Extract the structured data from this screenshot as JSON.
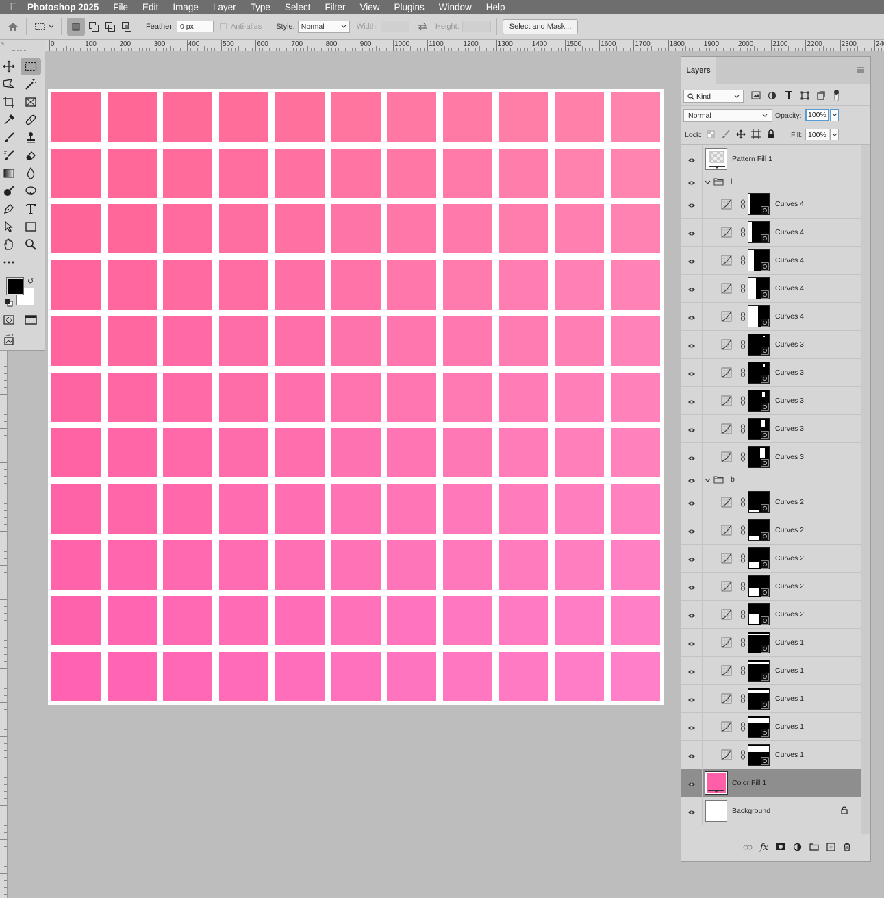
{
  "menubar": {
    "app_name": "Photoshop 2025",
    "items": [
      "File",
      "Edit",
      "Image",
      "Layer",
      "Type",
      "Select",
      "Filter",
      "View",
      "Plugins",
      "Window",
      "Help"
    ]
  },
  "options_bar": {
    "feather_label": "Feather:",
    "feather_value": "0 px",
    "anti_alias_label": "Anti-alias",
    "style_label": "Style:",
    "style_value": "Normal",
    "width_label": "Width:",
    "height_label": "Height:",
    "select_mask_label": "Select and Mask..."
  },
  "ruler": {
    "labels": [
      "0",
      "100",
      "200",
      "300",
      "400",
      "500",
      "600",
      "700",
      "800",
      "900",
      "1000",
      "1100",
      "1200",
      "1300",
      "1400",
      "1500",
      "1600",
      "1700",
      "1800",
      "1900",
      "2000",
      "2100",
      "2200",
      "2300",
      "240"
    ]
  },
  "colors": {
    "grid_top_left": "#ff6593",
    "grid_top_right": "#ff84ad",
    "grid_bottom_left": "#ff62b0",
    "grid_bottom_right": "#ff80c8",
    "color_fill": "#ff5fa8",
    "selected_row": "#8e8e8e"
  },
  "grid": {
    "rows": 11,
    "cols": 11
  },
  "layers_panel": {
    "tab_label": "Layers",
    "kind_label": "Kind",
    "blend_mode": "Normal",
    "opacity_label": "Opacity:",
    "opacity_value": "100%",
    "lock_label": "Lock:",
    "fill_label": "Fill:",
    "fill_value": "100%",
    "layers": [
      {
        "name": "Pattern Fill 1",
        "type": "pattern"
      },
      {
        "name": "l",
        "type": "group"
      },
      {
        "name": "Curves 4",
        "type": "curves",
        "shape": "vleft",
        "level": 0.05
      },
      {
        "name": "Curves 4",
        "type": "curves",
        "shape": "vleft",
        "level": 0.15
      },
      {
        "name": "Curves 4",
        "type": "curves",
        "shape": "vleft",
        "level": 0.25
      },
      {
        "name": "Curves 4",
        "type": "curves",
        "shape": "vleft",
        "level": 0.35
      },
      {
        "name": "Curves 4",
        "type": "curves",
        "shape": "vleft",
        "level": 0.45
      },
      {
        "name": "Curves 3",
        "type": "curves",
        "shape": "vright",
        "level": 0.08
      },
      {
        "name": "Curves 3",
        "type": "curves",
        "shape": "vright",
        "level": 0.18
      },
      {
        "name": "Curves 3",
        "type": "curves",
        "shape": "vright",
        "level": 0.28
      },
      {
        "name": "Curves 3",
        "type": "curves",
        "shape": "vright",
        "level": 0.38
      },
      {
        "name": "Curves 3",
        "type": "curves",
        "shape": "vright",
        "level": 0.48
      },
      {
        "name": "b",
        "type": "group"
      },
      {
        "name": "Curves 2",
        "type": "curves",
        "shape": "hbottom",
        "level": 0.08
      },
      {
        "name": "Curves 2",
        "type": "curves",
        "shape": "hbottom",
        "level": 0.18
      },
      {
        "name": "Curves 2",
        "type": "curves",
        "shape": "hbottom",
        "level": 0.28
      },
      {
        "name": "Curves 2",
        "type": "curves",
        "shape": "hbottom",
        "level": 0.38
      },
      {
        "name": "Curves 2",
        "type": "curves",
        "shape": "hbottom",
        "level": 0.48
      },
      {
        "name": "Curves 1",
        "type": "curves",
        "shape": "htop",
        "level": 0.1
      },
      {
        "name": "Curves 1",
        "type": "curves",
        "shape": "htop",
        "level": 0.2
      },
      {
        "name": "Curves 1",
        "type": "curves",
        "shape": "htop",
        "level": 0.3
      },
      {
        "name": "Curves 1",
        "type": "curves",
        "shape": "htop",
        "level": 0.4
      },
      {
        "name": "Curves 1",
        "type": "curves",
        "shape": "htop",
        "level": 0.5
      },
      {
        "name": "Color Fill 1",
        "type": "colorfill"
      },
      {
        "name": "Background",
        "type": "background"
      }
    ]
  }
}
